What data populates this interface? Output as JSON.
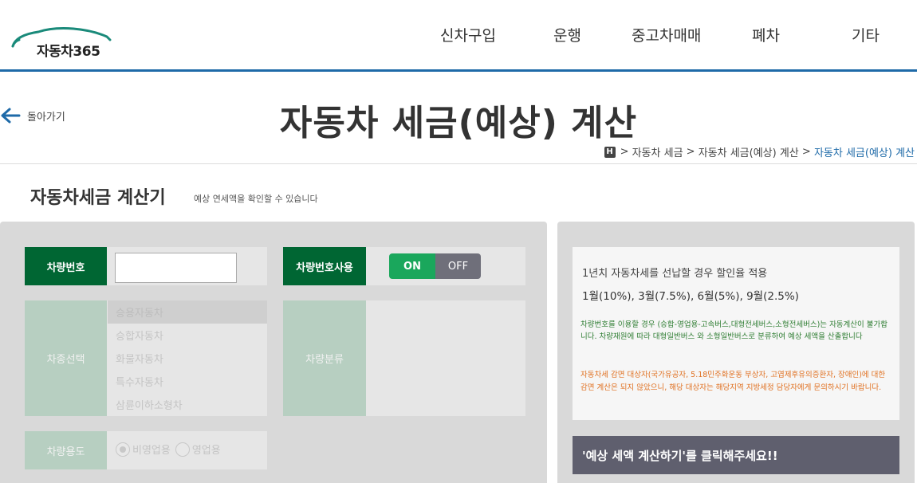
{
  "header": {
    "logo_text": "자동차365",
    "nav": [
      "신차구입",
      "운행",
      "중고차매매",
      "폐차",
      "기타"
    ]
  },
  "back_label": "돌아가기",
  "page_title": "자동차 세금(예상) 계산",
  "breadcrumb": {
    "home_icon_label": "H",
    "item1": "자동차 세금",
    "item2": "자동차 세금(예상) 계산",
    "current": "자동차 세금(예상) 계산"
  },
  "section": {
    "title": "자동차세금 계산기",
    "subtitle": "예상 연세액을 확인할 수 있습니다"
  },
  "form": {
    "plate_label": "차량번호",
    "plate_value": "",
    "plate_use_label": "차량번호사용",
    "toggle_on": "ON",
    "toggle_off": "OFF",
    "toggle_state": "ON",
    "type_label": "차종선택",
    "type_options": [
      "승용자동차",
      "승합자동차",
      "화물자동차",
      "특수자동차",
      "삼륜이하소형차"
    ],
    "type_selected": "승용자동차",
    "class_label": "차량분류",
    "usage_label": "차량용도",
    "usage_options": [
      "비영업용",
      "영업용"
    ],
    "usage_selected": "비영업용"
  },
  "info": {
    "line1": "1년치 자동차세를 선납할 경우 할인율 적용",
    "line2": "1월(10%), 3월(7.5%), 6월(5%), 9월(2.5%)",
    "green_note": "차량번호를 이용할 경우 (승합-영업용-고속버스,대형전세버스,소형전세버스)는 자동계산이 불가합니다. 차량재원에 따라 대형일반버스 와 소형일반버스로 분류하여 예상 세액을 산출합니다",
    "orange_note": "자동차세 감면 대상자(국가유공자, 5.18민주화운동 부상자, 고엽제후유의증환자, 장애인)에 대한 감면 계산은 되지 않았으니, 해당 대상자는 해당지역 지방세정 담당자에게 문의하시기 바랍니다."
  },
  "calc_prompt": "'예상 세액 계산하기'를 클릭해주세요!!",
  "colors": {
    "label_green": "#006633",
    "toggle_on": "#1aa75c",
    "toggle_off": "#6f6f7a",
    "header_line": "#1e6aa8",
    "calc_bar": "#5f5f6e"
  }
}
